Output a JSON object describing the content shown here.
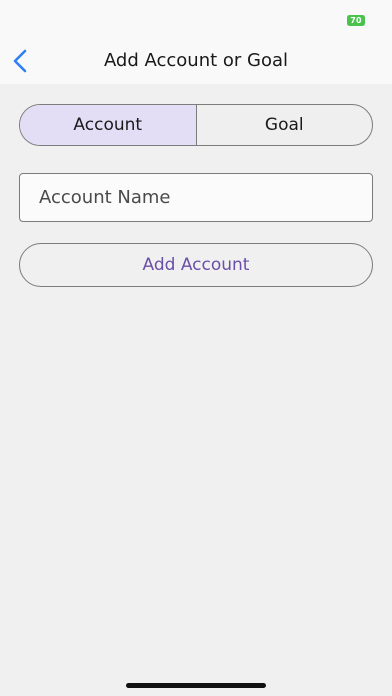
{
  "status_bar": {
    "battery_level": "70",
    "battery_color": "#4cc24e"
  },
  "nav": {
    "back_icon": "chevron-left-icon",
    "title": "Add Account or Goal",
    "accent_color": "#2f7ff5"
  },
  "segments": [
    {
      "label": "Account",
      "selected": true
    },
    {
      "label": "Goal",
      "selected": false
    }
  ],
  "form": {
    "name_placeholder": "Account Name",
    "name_value": "",
    "submit_label": "Add Account",
    "submit_color": "#6a4fa8"
  },
  "theme": {
    "background": "#f0f0f0",
    "selected_segment": "#e3ddf6"
  }
}
